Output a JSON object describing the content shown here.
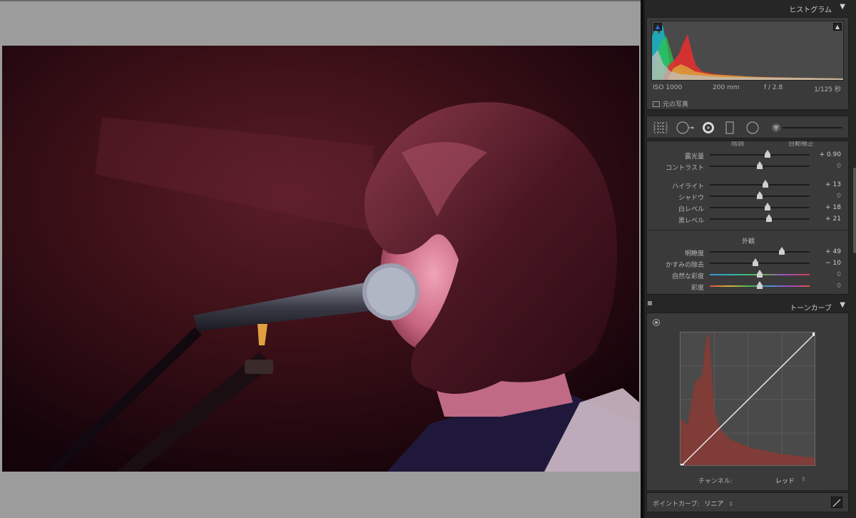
{
  "histogram": {
    "title": "ヒストグラム",
    "iso": "ISO 1000",
    "focal": "200 mm",
    "aperture": "f / 2.8",
    "shutter": "1/125 秒",
    "original_label": "元の写真"
  },
  "basic": {
    "top_left": "階調",
    "top_right": "自動補正",
    "sliders": [
      {
        "label": "露光量",
        "value": "+ 0.90",
        "level": 0.58
      },
      {
        "label": "コントラスト",
        "value": "0",
        "level": 0.5
      },
      {
        "label": "ハイライト",
        "value": "+ 13",
        "level": 0.56
      },
      {
        "label": "シャドウ",
        "value": "0",
        "level": 0.5
      },
      {
        "label": "白レベル",
        "value": "+ 18",
        "level": 0.58
      },
      {
        "label": "黒レベル",
        "value": "+ 21",
        "level": 0.59
      }
    ],
    "presence_title": "外観",
    "presence_sliders": [
      {
        "label": "明瞭度",
        "value": "+ 49",
        "level": 0.72
      },
      {
        "label": "かすみの除去",
        "value": "− 10",
        "level": 0.46
      },
      {
        "label": "自然な彩度",
        "value": "0",
        "level": 0.5
      },
      {
        "label": "彩度",
        "value": "0",
        "level": 0.5
      }
    ]
  },
  "tone_curve": {
    "title": "トーンカーブ",
    "channel_label": "チャンネル:",
    "channel_value": "レッド",
    "point_curve_label": "ポイントカーブ:",
    "point_curve_value": "リニア"
  },
  "icons": {
    "collapse": "▼",
    "clip_shadow": "▲",
    "clip_highlight": "▲",
    "updown": "⇕"
  },
  "colors": {
    "panel_bg": "#262626",
    "section_bg": "#3a3a3a",
    "canvas_bg": "#9c9c9c"
  }
}
